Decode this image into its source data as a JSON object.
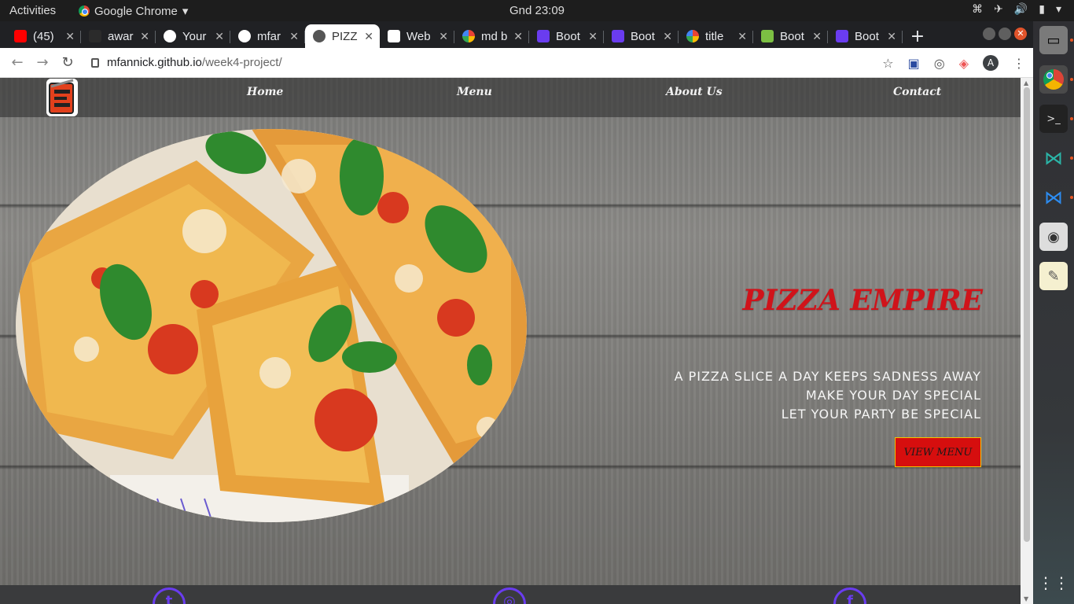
{
  "topbar": {
    "activities": "Activities",
    "app_name": "Google Chrome",
    "clock": "Gnd 23:09"
  },
  "browser": {
    "tabs": [
      {
        "title": "(45)",
        "favicon_color": "#ff0000"
      },
      {
        "title": "awar",
        "favicon_color": "#2b2b2b"
      },
      {
        "title": "Your",
        "favicon_color": "#ffffff"
      },
      {
        "title": "mfar",
        "favicon_color": "#ffffff"
      },
      {
        "title": "PIZZ",
        "favicon_color": "#555555"
      },
      {
        "title": "Web",
        "favicon_color": "#ffffff"
      },
      {
        "title": "md b",
        "favicon_color": "#4285f4"
      },
      {
        "title": "Boot",
        "favicon_color": "#6a3cf0"
      },
      {
        "title": "Boot",
        "favicon_color": "#6a3cf0"
      },
      {
        "title": "title",
        "favicon_color": "#4285f4"
      },
      {
        "title": "Boot",
        "favicon_color": "#7cc043"
      },
      {
        "title": "Boot",
        "favicon_color": "#6a3cf0"
      }
    ],
    "active_tab_index": 4,
    "url_host": "mfannick.github.io",
    "url_path": "/week4-project/",
    "profile_initial": "A"
  },
  "site": {
    "nav": [
      "Home",
      "Menu",
      "About Us",
      "Contact"
    ],
    "headline": "PIZZA EMPIRE",
    "taglines": [
      "A PIZZA SLICE A DAY KEEPS SADNESS AWAY",
      "MAKE YOUR DAY SPECIAL",
      "LET YOUR PARTY BE SPECIAL"
    ],
    "cta_label": "VIEW MENU",
    "social_icons": [
      "twitter-icon",
      "instagram-icon",
      "facebook-icon"
    ],
    "colors": {
      "accent_red": "#d0131a",
      "button_red": "#d60e0e",
      "button_border": "#f5c400",
      "social_purple": "#6a3cf0"
    }
  }
}
